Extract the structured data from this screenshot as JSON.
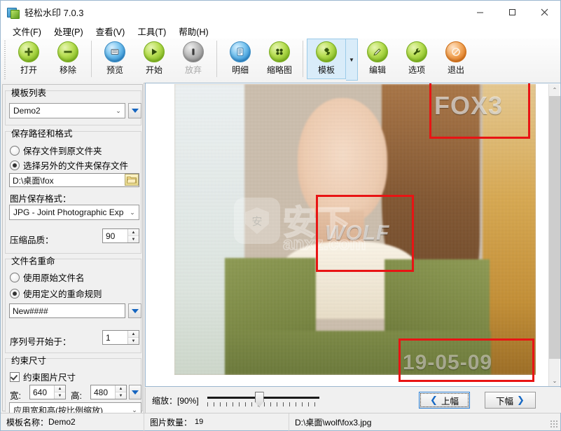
{
  "window": {
    "title": "轻松水印 7.0.3",
    "icon": "app-logo-icon",
    "minimize": "—",
    "maximize": "□",
    "close": "✕"
  },
  "menubar": {
    "items": [
      {
        "label": "文件(F)",
        "name": "menu-file"
      },
      {
        "label": "处理(P)",
        "name": "menu-process"
      },
      {
        "label": "查看(V)",
        "name": "menu-view"
      },
      {
        "label": "工具(T)",
        "name": "menu-tools"
      },
      {
        "label": "帮助(H)",
        "name": "menu-help"
      }
    ]
  },
  "toolbar": {
    "buttons": [
      {
        "label": "打开",
        "icon": "plus-circle-icon",
        "name": "toolbar-open"
      },
      {
        "label": "移除",
        "icon": "minus-circle-icon",
        "name": "toolbar-remove"
      },
      {
        "label": "预览",
        "icon": "preview-circle-icon",
        "name": "toolbar-preview"
      },
      {
        "label": "开始",
        "icon": "play-circle-icon",
        "name": "toolbar-start"
      },
      {
        "label": "放弃",
        "icon": "stop-circle-icon",
        "name": "toolbar-abort"
      },
      {
        "label": "明细",
        "icon": "details-list-icon",
        "name": "toolbar-details"
      },
      {
        "label": "缩略图",
        "icon": "thumbnails-icon",
        "name": "toolbar-thumbnails"
      },
      {
        "label": "模板",
        "icon": "puzzle-piece-icon",
        "name": "toolbar-template"
      },
      {
        "label": "编辑",
        "icon": "pencil-circle-icon",
        "name": "toolbar-edit"
      },
      {
        "label": "选项",
        "icon": "wrench-circle-icon",
        "name": "toolbar-options"
      },
      {
        "label": "退出",
        "icon": "exit-circle-icon",
        "name": "toolbar-exit"
      }
    ],
    "template_dropdown_arrow": "▼"
  },
  "sidebar": {
    "template_list": {
      "title": "模板列表",
      "selected": "Demo2",
      "dropdown_arrow": "▼"
    },
    "save_path": {
      "title": "保存路径和格式",
      "radio_original": "保存文件到原文件夹",
      "radio_other": "选择另外的文件夹保存文件",
      "selected": "other",
      "path_value": "D:\\桌面\\fox",
      "browse_icon": "folder-icon",
      "format_label": "图片保存格式：",
      "format_value": "JPG - Joint Photographic Experts ",
      "quality_label": "压缩品质：",
      "quality_value": "90"
    },
    "rename": {
      "title": "文件名重命",
      "radio_original": "使用原始文件名",
      "radio_custom": "使用定义的重命规则",
      "selected": "custom",
      "pattern_value": "New####",
      "dropdown_arrow": "▼",
      "start_label": "序列号开始于：",
      "start_value": "1"
    },
    "constrain": {
      "title": "约束尺寸",
      "checkbox_label": "约束图片尺寸",
      "checkbox_checked": true,
      "width_label": "宽:",
      "width_value": "640",
      "height_label": "高:",
      "height_value": "480",
      "dropdown_arrow": "▼",
      "mode_value": "应用宽和高(按比例缩放)"
    }
  },
  "preview": {
    "watermarks": [
      {
        "name": "watermark-fox3",
        "text": "FOX3"
      },
      {
        "name": "watermark-wolf",
        "text": "WOLF"
      },
      {
        "name": "watermark-date",
        "text": "19-05-09"
      }
    ],
    "site_watermark": {
      "big": "安下",
      "small": "anxz.com",
      "shield_char": "安"
    },
    "scrollbar": {
      "up": "⌃",
      "down": "⌄"
    }
  },
  "zoombar": {
    "zoom_label": "缩放：[90%]",
    "zoom_percent": "90%",
    "prev_label": "上幅",
    "prev_chevron": "❮",
    "next_label": "下幅",
    "next_chevron": "❯"
  },
  "statusbar": {
    "template_label": "模板名称：",
    "template_value": "Demo2",
    "count_label": "图片数量：",
    "count_value": "19",
    "file_path": "D:\\桌面\\wolf\\fox3.jpg"
  },
  "colors": {
    "accent_blue": "#1769c4",
    "select_blue": "#d9ecf9",
    "redbox": "#e81414",
    "green_orb": "#8ec12c"
  }
}
